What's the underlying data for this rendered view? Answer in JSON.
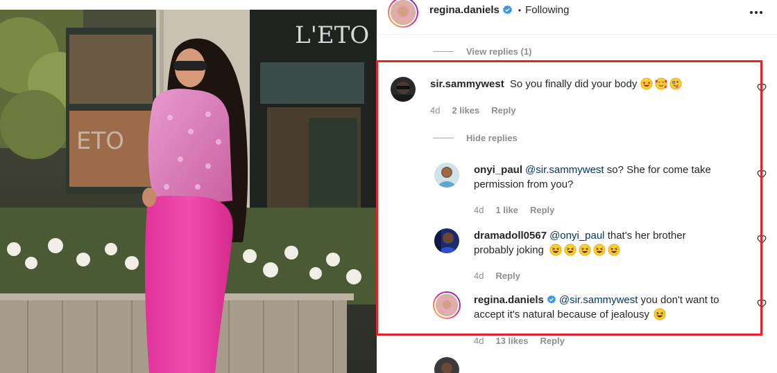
{
  "header": {
    "username": "regina.daniels",
    "verified": true,
    "separator": "•",
    "follow_status": "Following",
    "more_icon": "more-horizontal-icon"
  },
  "photo": {
    "storefront_sign": "L'ETO",
    "window_text": "ETO"
  },
  "view_replies": "View replies (1)",
  "hide_replies": "Hide replies",
  "comments": [
    {
      "username": "sir.sammywest",
      "text": "So you finally did your body",
      "emojis": [
        "star-struck-emoji",
        "smiling-hearts-emoji",
        "zany-face-emoji"
      ],
      "time": "4d",
      "likes": "2 likes",
      "reply": "Reply"
    }
  ],
  "replies": [
    {
      "username": "onyi_paul",
      "mention": "@sir.sammywest",
      "text_line1": "so? She for come take",
      "text_line2": "permission from you?",
      "time": "4d",
      "likes": "1 like",
      "reply": "Reply"
    },
    {
      "username": "dramadoll0567",
      "mention": "@onyi_paul",
      "text_line1": "that's her brother",
      "text_line2": "probably joking",
      "emojis": [
        "laughing-emoji",
        "laughing-emoji",
        "laughing-emoji",
        "laughing-emoji",
        "laughing-emoji"
      ],
      "time": "4d",
      "reply": "Reply"
    },
    {
      "username": "regina.daniels",
      "verified": true,
      "mention": "@sir.sammywest",
      "text_line1": "you don't want to",
      "text_line2": "accept it's natural because of jealousy",
      "emojis": [
        "laughing-emoji"
      ],
      "time": "4d",
      "likes": "13 likes",
      "reply": "Reply"
    }
  ],
  "colors": {
    "highlight_border": "#e3222a",
    "mention": "#00376b",
    "meta_text": "#8e8e8e",
    "verified_badge": "#3897f0"
  }
}
